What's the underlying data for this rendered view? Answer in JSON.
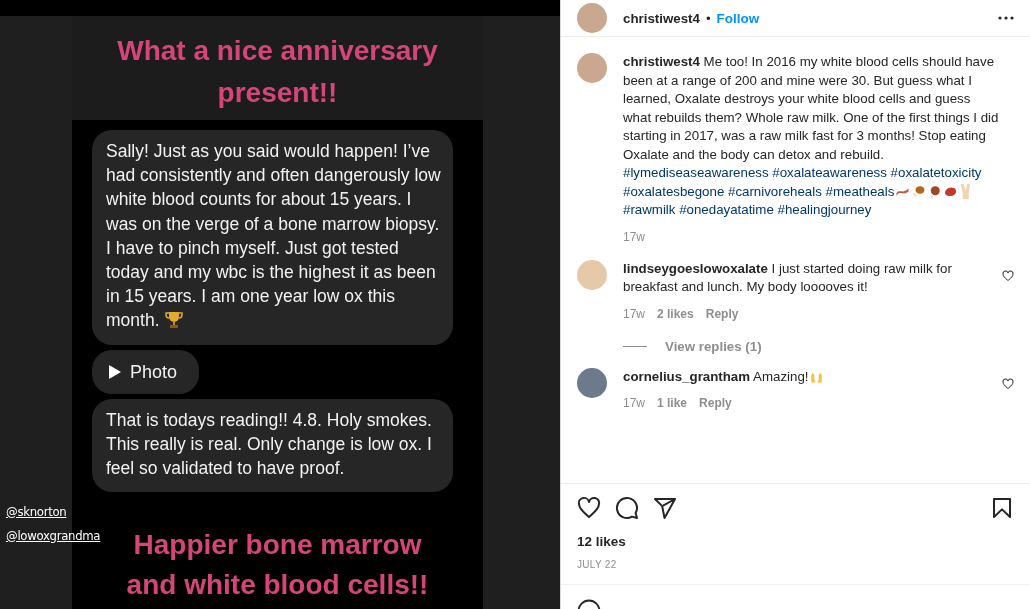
{
  "post_image": {
    "headline_top": "What a nice anniversary present!!",
    "messages": [
      {
        "kind": "text",
        "text": "Sally! Just as you said would happen! I’ve had consistently and often dangerously low white blood counts for about 15 years. I was on the verge of a bone marrow biopsy. I have to pinch myself. Just got tested today and my wbc is the highest it as been in 15 years. I am one year low ox this month."
      },
      {
        "kind": "attachment",
        "text": "Photo"
      },
      {
        "kind": "text",
        "text": "That is todays reading!! 4.8. Holy smokes. This really is real. Only change is low ox. I feel so validated to have proof."
      }
    ],
    "mentions": [
      "@sknorton",
      "@lowoxgrandma"
    ],
    "headline_bottom": "Happier bone marrow and white blood cells!!"
  },
  "header": {
    "username": "christiwest4",
    "separator": "•",
    "follow": "Follow"
  },
  "caption": {
    "username": "christiwest4",
    "text": "Me too! In 2016 my white blood cells should have been at a range of 200 and mine were 30. But guess what I learned, Oxalate destroys your white blood cells and guess what rebuilds them? Whole raw milk. One of the first things I did starting in 2017, was a raw milk fast for 3 months! Stop eating Oxalate and the body can detox and rebuild.",
    "hashtags": [
      "#lymediseaseawareness",
      "#oxalateawareness",
      "#oxalatetoxicity",
      "#oxalatesbegone",
      "#carnivoreheals",
      "#meatheals"
    ],
    "hashtags_after": [
      "#rawmilk",
      "#onedayatatime",
      "#healingjourney"
    ],
    "time": "17w"
  },
  "comments": [
    {
      "username": "lindseygoeslowoxalate",
      "text": "I just started doing raw milk for breakfast and lunch. My body looooves it!",
      "time": "17w",
      "likes": "2 likes",
      "reply": "Reply",
      "liked": false,
      "view_replies": "View replies (1)"
    },
    {
      "username": "cornelius_grantham",
      "text": "Amazing!",
      "time": "17w",
      "likes": "1 like",
      "reply": "Reply",
      "liked": false
    }
  ],
  "likes": "12 likes",
  "date": "JULY 22"
}
